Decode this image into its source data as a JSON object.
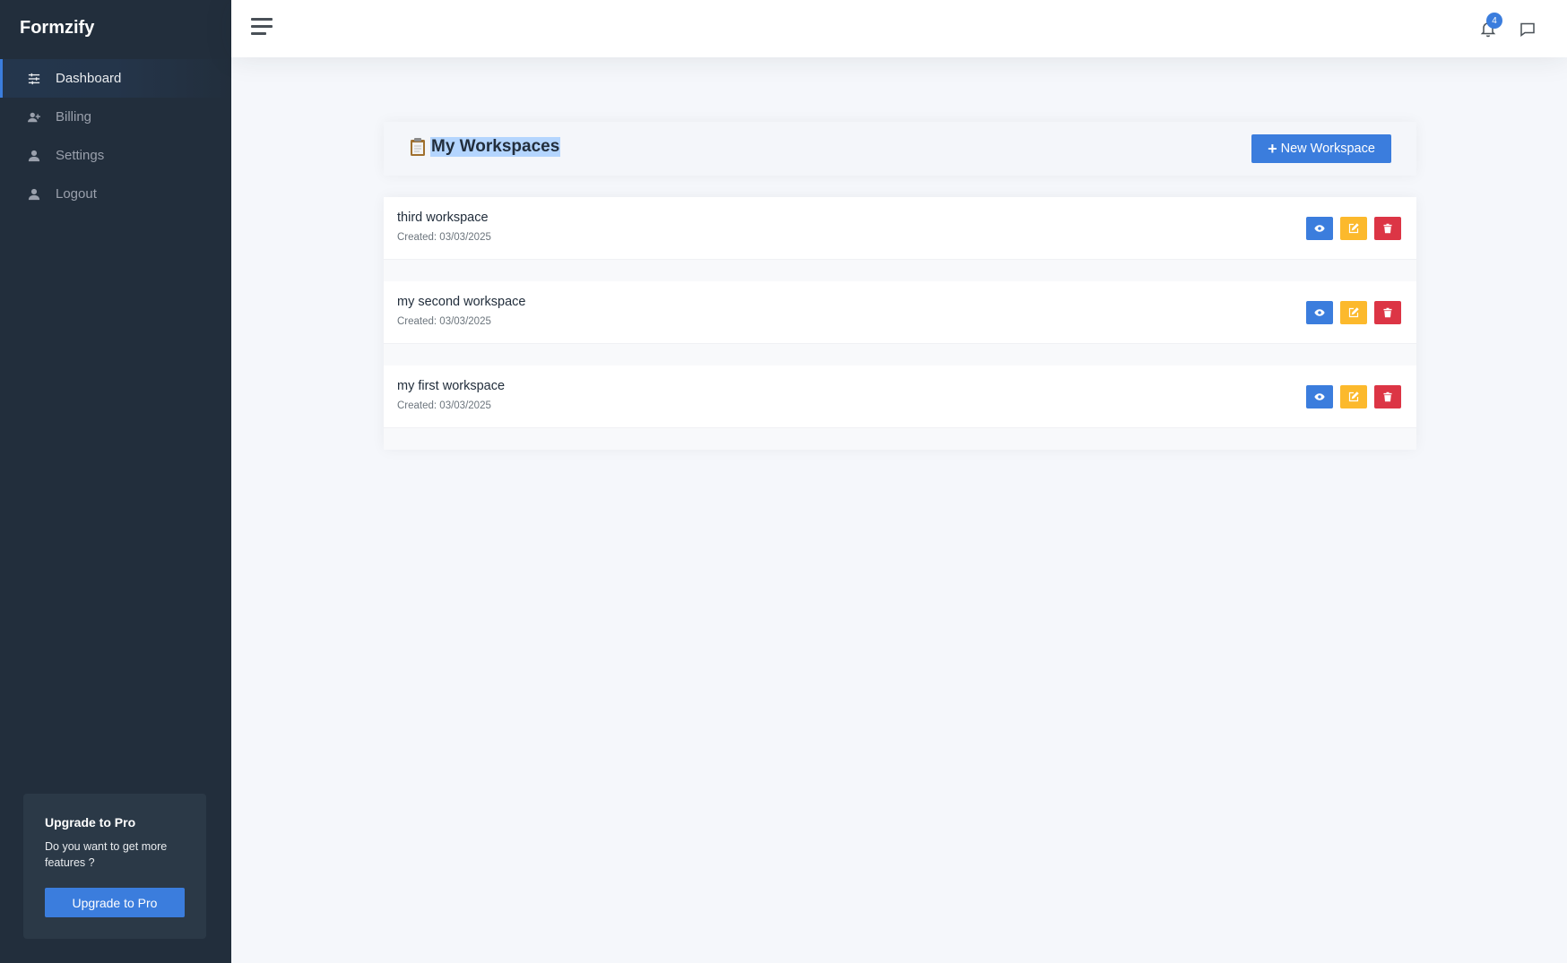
{
  "app": {
    "brand": "Formzify"
  },
  "sidebar": {
    "items": [
      {
        "label": "Dashboard",
        "icon": "sliders-icon",
        "active": true
      },
      {
        "label": "Billing",
        "icon": "user-plus-icon",
        "active": false
      },
      {
        "label": "Settings",
        "icon": "user-icon",
        "active": false
      },
      {
        "label": "Logout",
        "icon": "user-icon",
        "active": false
      }
    ],
    "upgrade": {
      "title": "Upgrade to Pro",
      "text": "Do you want to get more features ?",
      "button_label": "Upgrade to Pro"
    }
  },
  "topbar": {
    "notification_count": "4"
  },
  "main": {
    "title": "My Workspaces",
    "title_icon": "clipboard-icon",
    "new_button_label": "New Workspace",
    "workspaces": [
      {
        "name": "third workspace",
        "created": "Created: 03/03/2025"
      },
      {
        "name": "my second workspace",
        "created": "Created: 03/03/2025"
      },
      {
        "name": "my first workspace",
        "created": "Created: 03/03/2025"
      }
    ]
  },
  "colors": {
    "sidebar_bg": "#222e3c",
    "primary": "#3b7ddd",
    "warning": "#fcb92c",
    "danger": "#dc3545"
  }
}
